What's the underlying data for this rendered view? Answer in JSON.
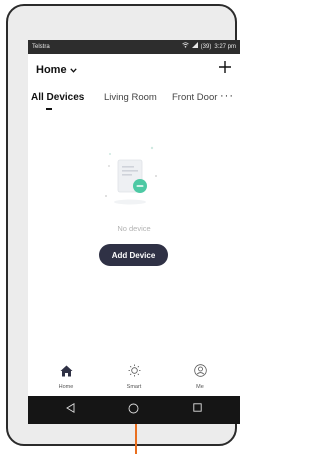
{
  "status": {
    "carrier": "Telstra",
    "battery": "(39)",
    "time": "3:27 pm",
    "icons": [
      "wifi-icon",
      "signal-icon",
      "battery-icon"
    ]
  },
  "header": {
    "title": "Home",
    "add_icon": "plus-icon"
  },
  "tabs": [
    {
      "label": "All Devices",
      "active": true
    },
    {
      "label": "Living Room",
      "active": false
    },
    {
      "label": "Front Door",
      "active": false
    }
  ],
  "tabs_more": "···",
  "empty": {
    "message": "No device",
    "button_label": "Add Device"
  },
  "bottom_nav": [
    {
      "label": "Home",
      "icon": "home-icon",
      "active": true
    },
    {
      "label": "Smart",
      "icon": "sun-icon",
      "active": false
    },
    {
      "label": "Me",
      "icon": "smiley-icon",
      "active": false
    }
  ],
  "system_nav": [
    "back-icon",
    "home-circle-icon",
    "recents-icon"
  ],
  "colors": {
    "highlight": "#e96f1f",
    "button_bg": "#2f3145",
    "accent_green": "#4dc9a4"
  }
}
